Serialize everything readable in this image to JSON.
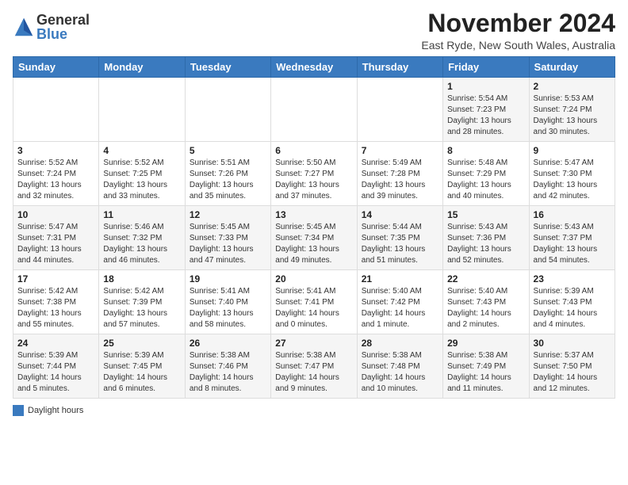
{
  "logo": {
    "general": "General",
    "blue": "Blue"
  },
  "title": "November 2024",
  "subtitle": "East Ryde, New South Wales, Australia",
  "headers": [
    "Sunday",
    "Monday",
    "Tuesday",
    "Wednesday",
    "Thursday",
    "Friday",
    "Saturday"
  ],
  "legend": "Daylight hours",
  "weeks": [
    [
      {
        "day": "",
        "detail": ""
      },
      {
        "day": "",
        "detail": ""
      },
      {
        "day": "",
        "detail": ""
      },
      {
        "day": "",
        "detail": ""
      },
      {
        "day": "",
        "detail": ""
      },
      {
        "day": "1",
        "detail": "Sunrise: 5:54 AM\nSunset: 7:23 PM\nDaylight: 13 hours\nand 28 minutes."
      },
      {
        "day": "2",
        "detail": "Sunrise: 5:53 AM\nSunset: 7:24 PM\nDaylight: 13 hours\nand 30 minutes."
      }
    ],
    [
      {
        "day": "3",
        "detail": "Sunrise: 5:52 AM\nSunset: 7:24 PM\nDaylight: 13 hours\nand 32 minutes."
      },
      {
        "day": "4",
        "detail": "Sunrise: 5:52 AM\nSunset: 7:25 PM\nDaylight: 13 hours\nand 33 minutes."
      },
      {
        "day": "5",
        "detail": "Sunrise: 5:51 AM\nSunset: 7:26 PM\nDaylight: 13 hours\nand 35 minutes."
      },
      {
        "day": "6",
        "detail": "Sunrise: 5:50 AM\nSunset: 7:27 PM\nDaylight: 13 hours\nand 37 minutes."
      },
      {
        "day": "7",
        "detail": "Sunrise: 5:49 AM\nSunset: 7:28 PM\nDaylight: 13 hours\nand 39 minutes."
      },
      {
        "day": "8",
        "detail": "Sunrise: 5:48 AM\nSunset: 7:29 PM\nDaylight: 13 hours\nand 40 minutes."
      },
      {
        "day": "9",
        "detail": "Sunrise: 5:47 AM\nSunset: 7:30 PM\nDaylight: 13 hours\nand 42 minutes."
      }
    ],
    [
      {
        "day": "10",
        "detail": "Sunrise: 5:47 AM\nSunset: 7:31 PM\nDaylight: 13 hours\nand 44 minutes."
      },
      {
        "day": "11",
        "detail": "Sunrise: 5:46 AM\nSunset: 7:32 PM\nDaylight: 13 hours\nand 46 minutes."
      },
      {
        "day": "12",
        "detail": "Sunrise: 5:45 AM\nSunset: 7:33 PM\nDaylight: 13 hours\nand 47 minutes."
      },
      {
        "day": "13",
        "detail": "Sunrise: 5:45 AM\nSunset: 7:34 PM\nDaylight: 13 hours\nand 49 minutes."
      },
      {
        "day": "14",
        "detail": "Sunrise: 5:44 AM\nSunset: 7:35 PM\nDaylight: 13 hours\nand 51 minutes."
      },
      {
        "day": "15",
        "detail": "Sunrise: 5:43 AM\nSunset: 7:36 PM\nDaylight: 13 hours\nand 52 minutes."
      },
      {
        "day": "16",
        "detail": "Sunrise: 5:43 AM\nSunset: 7:37 PM\nDaylight: 13 hours\nand 54 minutes."
      }
    ],
    [
      {
        "day": "17",
        "detail": "Sunrise: 5:42 AM\nSunset: 7:38 PM\nDaylight: 13 hours\nand 55 minutes."
      },
      {
        "day": "18",
        "detail": "Sunrise: 5:42 AM\nSunset: 7:39 PM\nDaylight: 13 hours\nand 57 minutes."
      },
      {
        "day": "19",
        "detail": "Sunrise: 5:41 AM\nSunset: 7:40 PM\nDaylight: 13 hours\nand 58 minutes."
      },
      {
        "day": "20",
        "detail": "Sunrise: 5:41 AM\nSunset: 7:41 PM\nDaylight: 14 hours\nand 0 minutes."
      },
      {
        "day": "21",
        "detail": "Sunrise: 5:40 AM\nSunset: 7:42 PM\nDaylight: 14 hours\nand 1 minute."
      },
      {
        "day": "22",
        "detail": "Sunrise: 5:40 AM\nSunset: 7:43 PM\nDaylight: 14 hours\nand 2 minutes."
      },
      {
        "day": "23",
        "detail": "Sunrise: 5:39 AM\nSunset: 7:43 PM\nDaylight: 14 hours\nand 4 minutes."
      }
    ],
    [
      {
        "day": "24",
        "detail": "Sunrise: 5:39 AM\nSunset: 7:44 PM\nDaylight: 14 hours\nand 5 minutes."
      },
      {
        "day": "25",
        "detail": "Sunrise: 5:39 AM\nSunset: 7:45 PM\nDaylight: 14 hours\nand 6 minutes."
      },
      {
        "day": "26",
        "detail": "Sunrise: 5:38 AM\nSunset: 7:46 PM\nDaylight: 14 hours\nand 8 minutes."
      },
      {
        "day": "27",
        "detail": "Sunrise: 5:38 AM\nSunset: 7:47 PM\nDaylight: 14 hours\nand 9 minutes."
      },
      {
        "day": "28",
        "detail": "Sunrise: 5:38 AM\nSunset: 7:48 PM\nDaylight: 14 hours\nand 10 minutes."
      },
      {
        "day": "29",
        "detail": "Sunrise: 5:38 AM\nSunset: 7:49 PM\nDaylight: 14 hours\nand 11 minutes."
      },
      {
        "day": "30",
        "detail": "Sunrise: 5:37 AM\nSunset: 7:50 PM\nDaylight: 14 hours\nand 12 minutes."
      }
    ]
  ]
}
